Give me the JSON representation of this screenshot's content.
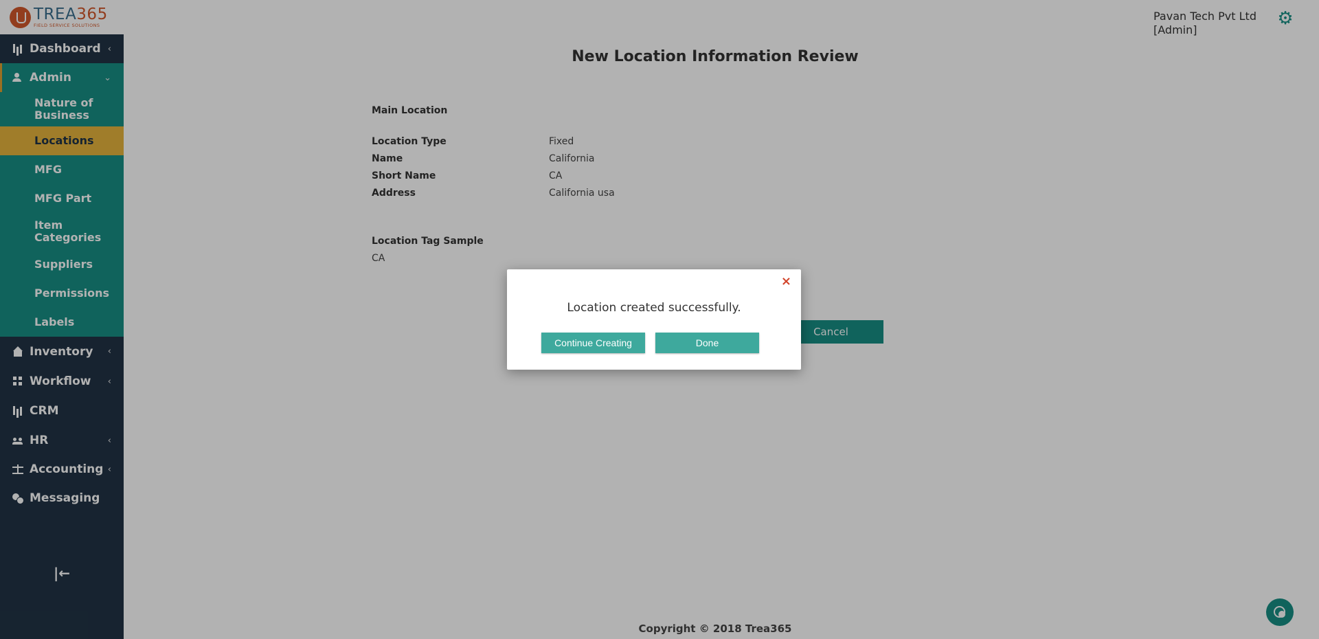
{
  "brand": {
    "logo_main": "TREA",
    "logo_accent": "365",
    "logo_sub": "FIELD SERVICE SOLUTIONS"
  },
  "header": {
    "company_line1": "Pavan Tech Pvt Ltd",
    "company_line2": "[Admin]",
    "settings_icon": "gear-icon"
  },
  "sidebar": {
    "items": [
      {
        "label": "Dashboard",
        "icon": "bar-chart-icon",
        "expanded": false
      },
      {
        "label": "Admin",
        "icon": "person-icon",
        "expanded": true
      },
      {
        "label": "Inventory",
        "icon": "home-icon",
        "expanded": false
      },
      {
        "label": "Workflow",
        "icon": "workflow-icon",
        "expanded": false
      },
      {
        "label": "CRM",
        "icon": "bar-chart-icon"
      },
      {
        "label": "HR",
        "icon": "people-icon",
        "expanded": false
      },
      {
        "label": "Accounting",
        "icon": "scale-icon",
        "expanded": false
      },
      {
        "label": "Messaging",
        "icon": "chat-icon"
      }
    ],
    "admin_subitems": [
      {
        "label": "Nature of Business",
        "active": false
      },
      {
        "label": "Locations",
        "active": true
      },
      {
        "label": "MFG",
        "active": false
      },
      {
        "label": "MFG Part",
        "active": false
      },
      {
        "label": "Item Categories",
        "active": false
      },
      {
        "label": "Suppliers",
        "active": false
      },
      {
        "label": "Permissions",
        "active": false
      },
      {
        "label": "Labels",
        "active": false
      }
    ],
    "collapse_icon": "collapse-left-icon"
  },
  "main": {
    "title": "New Location Information Review",
    "section_main": "Main Location",
    "fields": [
      {
        "label": "Location Type",
        "value": "Fixed"
      },
      {
        "label": "Name",
        "value": "California"
      },
      {
        "label": "Short Name",
        "value": "CA"
      },
      {
        "label": "Address",
        "value": "California usa"
      }
    ],
    "tag_section": "Location Tag Sample",
    "tag_value": "CA",
    "cancel_label": "Cancel"
  },
  "footer": {
    "copyright": "Copyright © 2018 Trea365"
  },
  "modal": {
    "message": "Location created successfully.",
    "continue_label": "Continue Creating",
    "done_label": "Done",
    "close_glyph": "×"
  },
  "colors": {
    "sidebar_bg": "#213345",
    "teal": "#178f85",
    "active_item": "#e6b43d",
    "brand_orange": "#d2582b"
  }
}
